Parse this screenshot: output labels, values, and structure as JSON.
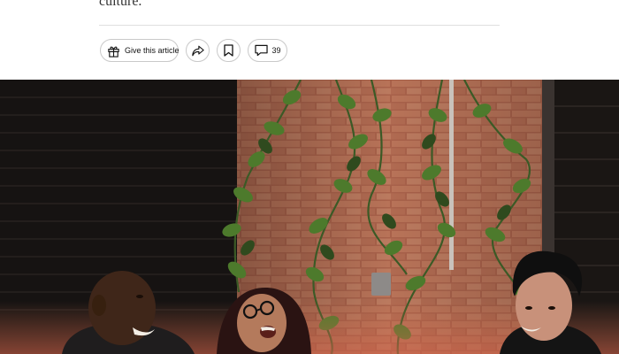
{
  "article": {
    "lede_tail": "culture."
  },
  "toolbar": {
    "gift_label": "Give this article",
    "gift_icon": "gift-icon",
    "share_icon": "share-arrow-icon",
    "save_icon": "bookmark-icon",
    "comments_icon": "comment-bubble-icon",
    "comments_count": "39"
  },
  "hero": {
    "alt": "Photo of three people laughing together in front of a brick wall covered with ivy"
  }
}
